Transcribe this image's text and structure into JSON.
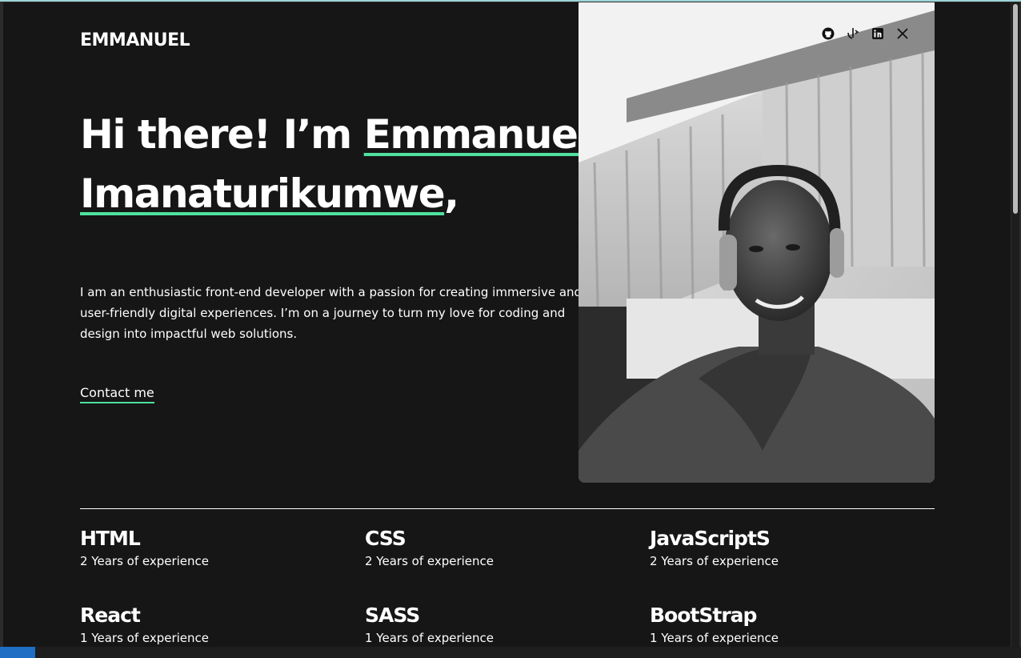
{
  "site": {
    "logo": "EMMANUEL",
    "headline_prefix": "Hi there! I’m ",
    "headline_name_1": "Emmanuel",
    "headline_name_2": "Imanaturikumwe",
    "headline_suffix": ",",
    "intro": "I am an enthusiastic front-end developer with a passion for creating immersive and user-friendly digital experiences. I’m on a journey to turn my love for coding and design into impactful web solutions.",
    "contact_label": "Contact me"
  },
  "socials": [
    {
      "icon": "github-icon"
    },
    {
      "icon": "frontend-mentor-icon"
    },
    {
      "icon": "linkedin-icon"
    },
    {
      "icon": "x-icon"
    }
  ],
  "skills": [
    {
      "name": "HTML",
      "experience": "2 Years of experience"
    },
    {
      "name": "CSS",
      "experience": "2 Years of experience"
    },
    {
      "name": "JavaScriptS",
      "experience": "2 Years of experience"
    },
    {
      "name": "React",
      "experience": "1 Years of experience"
    },
    {
      "name": "SASS",
      "experience": "1 Years of experience"
    },
    {
      "name": "BootStrap",
      "experience": "1 Years of experience"
    }
  ],
  "colors": {
    "background": "#161616",
    "accent": "#4ee1a0",
    "text": "#ffffff"
  }
}
